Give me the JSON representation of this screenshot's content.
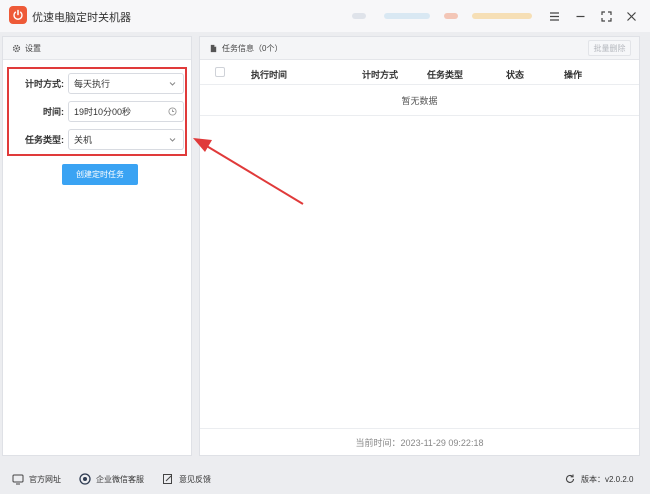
{
  "window": {
    "title": "优速电脑定时关机器"
  },
  "settings_panel": {
    "header_label": "设置",
    "fields": [
      {
        "label": "计时方式:",
        "value": "每天执行",
        "type": "select"
      },
      {
        "label": "时间:",
        "value": "19时10分00秒",
        "type": "time"
      },
      {
        "label": "任务类型:",
        "value": "关机",
        "type": "select"
      }
    ],
    "create_button": "创建定时任务"
  },
  "task_panel": {
    "header_label": "任务信息（0个）",
    "batch_delete": "批量删除",
    "columns": [
      "执行时间",
      "计时方式",
      "任务类型",
      "状态",
      "操作"
    ],
    "empty_text": "暂无数据",
    "footer_time": "当前时间：2023-11-29 09:22:18"
  },
  "statusbar": {
    "website": "官方网址",
    "wechat": "企业微信客服",
    "feedback": "意见反馈",
    "version": "版本：v2.0.2.0"
  },
  "colors": {
    "accent": "#3aa3f3",
    "app_icon": "#ee5a38",
    "annotation": "#e03a3a"
  }
}
